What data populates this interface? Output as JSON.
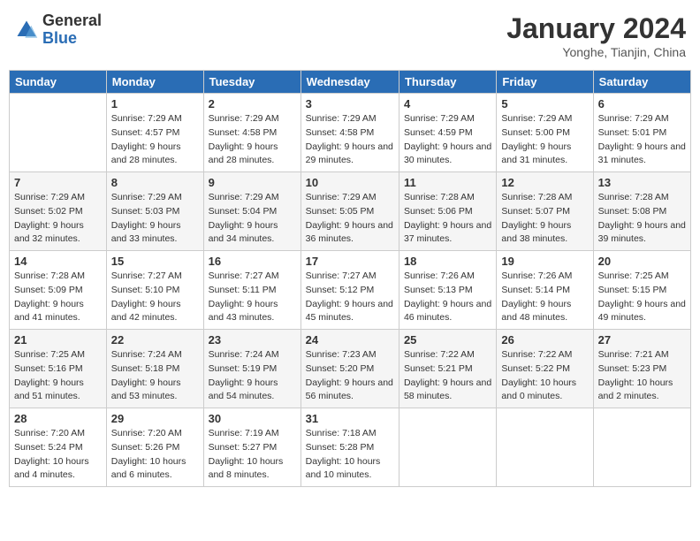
{
  "header": {
    "logo_general": "General",
    "logo_blue": "Blue",
    "month_title": "January 2024",
    "location": "Yonghe, Tianjin, China"
  },
  "days_of_week": [
    "Sunday",
    "Monday",
    "Tuesday",
    "Wednesday",
    "Thursday",
    "Friday",
    "Saturday"
  ],
  "weeks": [
    [
      {
        "day": "",
        "sunrise": "",
        "sunset": "",
        "daylight": ""
      },
      {
        "day": "1",
        "sunrise": "Sunrise: 7:29 AM",
        "sunset": "Sunset: 4:57 PM",
        "daylight": "Daylight: 9 hours and 28 minutes."
      },
      {
        "day": "2",
        "sunrise": "Sunrise: 7:29 AM",
        "sunset": "Sunset: 4:58 PM",
        "daylight": "Daylight: 9 hours and 28 minutes."
      },
      {
        "day": "3",
        "sunrise": "Sunrise: 7:29 AM",
        "sunset": "Sunset: 4:58 PM",
        "daylight": "Daylight: 9 hours and 29 minutes."
      },
      {
        "day": "4",
        "sunrise": "Sunrise: 7:29 AM",
        "sunset": "Sunset: 4:59 PM",
        "daylight": "Daylight: 9 hours and 30 minutes."
      },
      {
        "day": "5",
        "sunrise": "Sunrise: 7:29 AM",
        "sunset": "Sunset: 5:00 PM",
        "daylight": "Daylight: 9 hours and 31 minutes."
      },
      {
        "day": "6",
        "sunrise": "Sunrise: 7:29 AM",
        "sunset": "Sunset: 5:01 PM",
        "daylight": "Daylight: 9 hours and 31 minutes."
      }
    ],
    [
      {
        "day": "7",
        "sunrise": "Sunrise: 7:29 AM",
        "sunset": "Sunset: 5:02 PM",
        "daylight": "Daylight: 9 hours and 32 minutes."
      },
      {
        "day": "8",
        "sunrise": "Sunrise: 7:29 AM",
        "sunset": "Sunset: 5:03 PM",
        "daylight": "Daylight: 9 hours and 33 minutes."
      },
      {
        "day": "9",
        "sunrise": "Sunrise: 7:29 AM",
        "sunset": "Sunset: 5:04 PM",
        "daylight": "Daylight: 9 hours and 34 minutes."
      },
      {
        "day": "10",
        "sunrise": "Sunrise: 7:29 AM",
        "sunset": "Sunset: 5:05 PM",
        "daylight": "Daylight: 9 hours and 36 minutes."
      },
      {
        "day": "11",
        "sunrise": "Sunrise: 7:28 AM",
        "sunset": "Sunset: 5:06 PM",
        "daylight": "Daylight: 9 hours and 37 minutes."
      },
      {
        "day": "12",
        "sunrise": "Sunrise: 7:28 AM",
        "sunset": "Sunset: 5:07 PM",
        "daylight": "Daylight: 9 hours and 38 minutes."
      },
      {
        "day": "13",
        "sunrise": "Sunrise: 7:28 AM",
        "sunset": "Sunset: 5:08 PM",
        "daylight": "Daylight: 9 hours and 39 minutes."
      }
    ],
    [
      {
        "day": "14",
        "sunrise": "Sunrise: 7:28 AM",
        "sunset": "Sunset: 5:09 PM",
        "daylight": "Daylight: 9 hours and 41 minutes."
      },
      {
        "day": "15",
        "sunrise": "Sunrise: 7:27 AM",
        "sunset": "Sunset: 5:10 PM",
        "daylight": "Daylight: 9 hours and 42 minutes."
      },
      {
        "day": "16",
        "sunrise": "Sunrise: 7:27 AM",
        "sunset": "Sunset: 5:11 PM",
        "daylight": "Daylight: 9 hours and 43 minutes."
      },
      {
        "day": "17",
        "sunrise": "Sunrise: 7:27 AM",
        "sunset": "Sunset: 5:12 PM",
        "daylight": "Daylight: 9 hours and 45 minutes."
      },
      {
        "day": "18",
        "sunrise": "Sunrise: 7:26 AM",
        "sunset": "Sunset: 5:13 PM",
        "daylight": "Daylight: 9 hours and 46 minutes."
      },
      {
        "day": "19",
        "sunrise": "Sunrise: 7:26 AM",
        "sunset": "Sunset: 5:14 PM",
        "daylight": "Daylight: 9 hours and 48 minutes."
      },
      {
        "day": "20",
        "sunrise": "Sunrise: 7:25 AM",
        "sunset": "Sunset: 5:15 PM",
        "daylight": "Daylight: 9 hours and 49 minutes."
      }
    ],
    [
      {
        "day": "21",
        "sunrise": "Sunrise: 7:25 AM",
        "sunset": "Sunset: 5:16 PM",
        "daylight": "Daylight: 9 hours and 51 minutes."
      },
      {
        "day": "22",
        "sunrise": "Sunrise: 7:24 AM",
        "sunset": "Sunset: 5:18 PM",
        "daylight": "Daylight: 9 hours and 53 minutes."
      },
      {
        "day": "23",
        "sunrise": "Sunrise: 7:24 AM",
        "sunset": "Sunset: 5:19 PM",
        "daylight": "Daylight: 9 hours and 54 minutes."
      },
      {
        "day": "24",
        "sunrise": "Sunrise: 7:23 AM",
        "sunset": "Sunset: 5:20 PM",
        "daylight": "Daylight: 9 hours and 56 minutes."
      },
      {
        "day": "25",
        "sunrise": "Sunrise: 7:22 AM",
        "sunset": "Sunset: 5:21 PM",
        "daylight": "Daylight: 9 hours and 58 minutes."
      },
      {
        "day": "26",
        "sunrise": "Sunrise: 7:22 AM",
        "sunset": "Sunset: 5:22 PM",
        "daylight": "Daylight: 10 hours and 0 minutes."
      },
      {
        "day": "27",
        "sunrise": "Sunrise: 7:21 AM",
        "sunset": "Sunset: 5:23 PM",
        "daylight": "Daylight: 10 hours and 2 minutes."
      }
    ],
    [
      {
        "day": "28",
        "sunrise": "Sunrise: 7:20 AM",
        "sunset": "Sunset: 5:24 PM",
        "daylight": "Daylight: 10 hours and 4 minutes."
      },
      {
        "day": "29",
        "sunrise": "Sunrise: 7:20 AM",
        "sunset": "Sunset: 5:26 PM",
        "daylight": "Daylight: 10 hours and 6 minutes."
      },
      {
        "day": "30",
        "sunrise": "Sunrise: 7:19 AM",
        "sunset": "Sunset: 5:27 PM",
        "daylight": "Daylight: 10 hours and 8 minutes."
      },
      {
        "day": "31",
        "sunrise": "Sunrise: 7:18 AM",
        "sunset": "Sunset: 5:28 PM",
        "daylight": "Daylight: 10 hours and 10 minutes."
      },
      {
        "day": "",
        "sunrise": "",
        "sunset": "",
        "daylight": ""
      },
      {
        "day": "",
        "sunrise": "",
        "sunset": "",
        "daylight": ""
      },
      {
        "day": "",
        "sunrise": "",
        "sunset": "",
        "daylight": ""
      }
    ]
  ]
}
